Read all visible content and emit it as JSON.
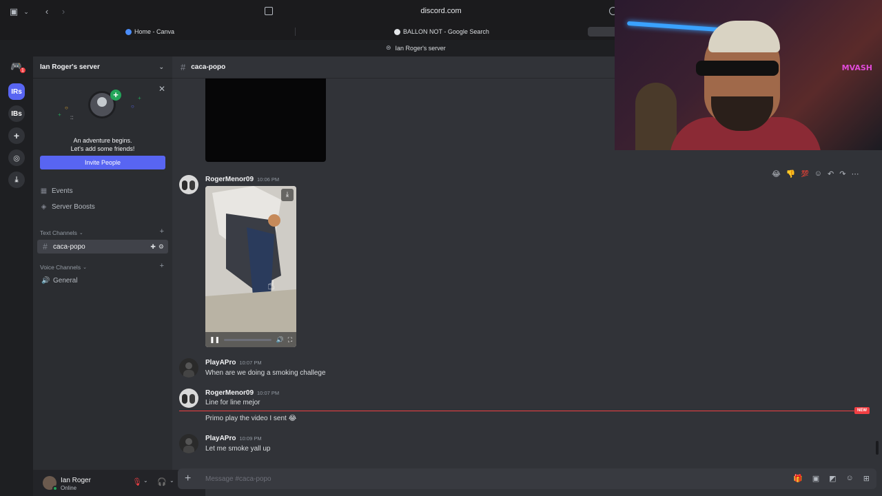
{
  "browser": {
    "url": "discord.com",
    "tabs": [
      {
        "label": "Home - Canva"
      },
      {
        "label": "BALLON NOT - Google Search"
      }
    ],
    "title_bar": "Ian Roger's server"
  },
  "guilds": {
    "badge": "1",
    "items": [
      {
        "label": "IRs"
      },
      {
        "label": "IBs"
      }
    ]
  },
  "sidebar": {
    "server_name": "Ian Roger's server",
    "promo": {
      "line1": "An adventure begins.",
      "line2": "Let's add some friends!",
      "button": "Invite People"
    },
    "events_label": "Events",
    "boosts_label": "Server Boosts",
    "text_category": "Text Channels",
    "text_channels": [
      {
        "name": "caca-popo"
      }
    ],
    "voice_category": "Voice Channels",
    "voice_channels": [
      {
        "name": "General"
      }
    ]
  },
  "user": {
    "name": "Ian Roger",
    "status": "Online"
  },
  "chat": {
    "channel_name": "caca-popo",
    "messages": [
      {
        "author": "RogerMenor09",
        "time": "10:06 PM"
      },
      {
        "author": "PlayAPro",
        "time": "10:07 PM",
        "text": "When are we doing a smoking challege"
      },
      {
        "author": "RogerMenor09",
        "time": "10:07 PM",
        "text": "Line for line mejor"
      },
      {
        "text": "Primo play the video I sent 😂"
      },
      {
        "author": "PlayAPro",
        "time": "10:09 PM",
        "text": "Let me smoke yall up"
      }
    ],
    "new_label": "NEW",
    "hover_emojis": [
      "😂",
      "👎",
      "💯"
    ],
    "composer_placeholder": "Message #caca-popo"
  },
  "colors": {
    "accent": "#5865f2",
    "online": "#23a55a",
    "new_divider": "#f23f43"
  }
}
